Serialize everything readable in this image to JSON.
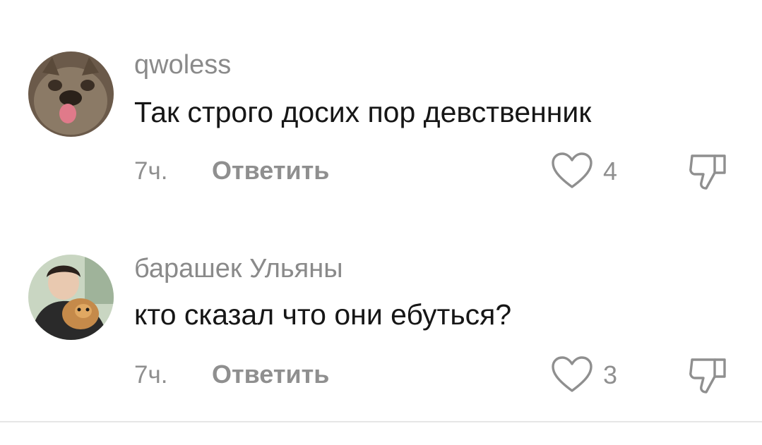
{
  "comments": [
    {
      "username": "qwoless",
      "text": "Так строго досих пор девственник",
      "time": "7ч.",
      "reply_label": "Ответить",
      "likes": "4",
      "avatar_icon": "dog-avatar",
      "avatar_colors": {
        "bg": "#6b5a4a",
        "fur": "#8b7a66",
        "tongue": "#e07a8a"
      }
    },
    {
      "username": "барашек Ульяны",
      "text": "кто сказал что они ебуться?",
      "time": "7ч.",
      "reply_label": "Ответить",
      "likes": "3",
      "avatar_icon": "person-with-dog-avatar",
      "avatar_colors": {
        "bg": "#c9d6c2",
        "shirt": "#2a2a2a",
        "dog": "#c58a4a"
      }
    }
  ],
  "icons": {
    "like": "heart-outline-icon",
    "dislike": "thumbs-down-outline-icon"
  },
  "colors": {
    "username": "#8a8a8a",
    "text": "#161616",
    "meta": "#8f8f8f",
    "divider": "#e6e6e6"
  }
}
